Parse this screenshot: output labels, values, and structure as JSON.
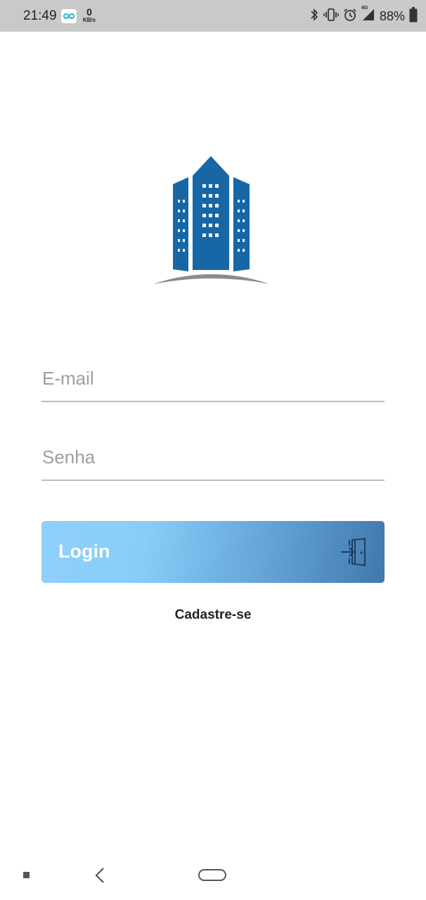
{
  "status_bar": {
    "time": "21:49",
    "network_speed_value": "0",
    "network_speed_unit": "KB/s",
    "network_type": "4G",
    "battery_percent": "88%",
    "icons": [
      "infinity-app-icon",
      "bluetooth-icon",
      "vibrate-icon",
      "alarm-icon",
      "signal-icon",
      "battery-icon"
    ]
  },
  "logo": {
    "icon": "building-logo-icon",
    "colors": {
      "building": "#1767a6",
      "ground": "#8c8c8c"
    }
  },
  "form": {
    "email_placeholder": "E-mail",
    "email_value": "",
    "password_placeholder": "Senha",
    "password_value": ""
  },
  "login_button": {
    "label": "Login",
    "icon": "door-enter-icon",
    "colors": {
      "gradient_start": "#8fd0fb",
      "gradient_end": "#4178ad"
    }
  },
  "signup_link": {
    "label": "Cadastre-se"
  },
  "nav_bar": {
    "buttons": [
      "recents-button",
      "back-button",
      "home-button"
    ]
  }
}
